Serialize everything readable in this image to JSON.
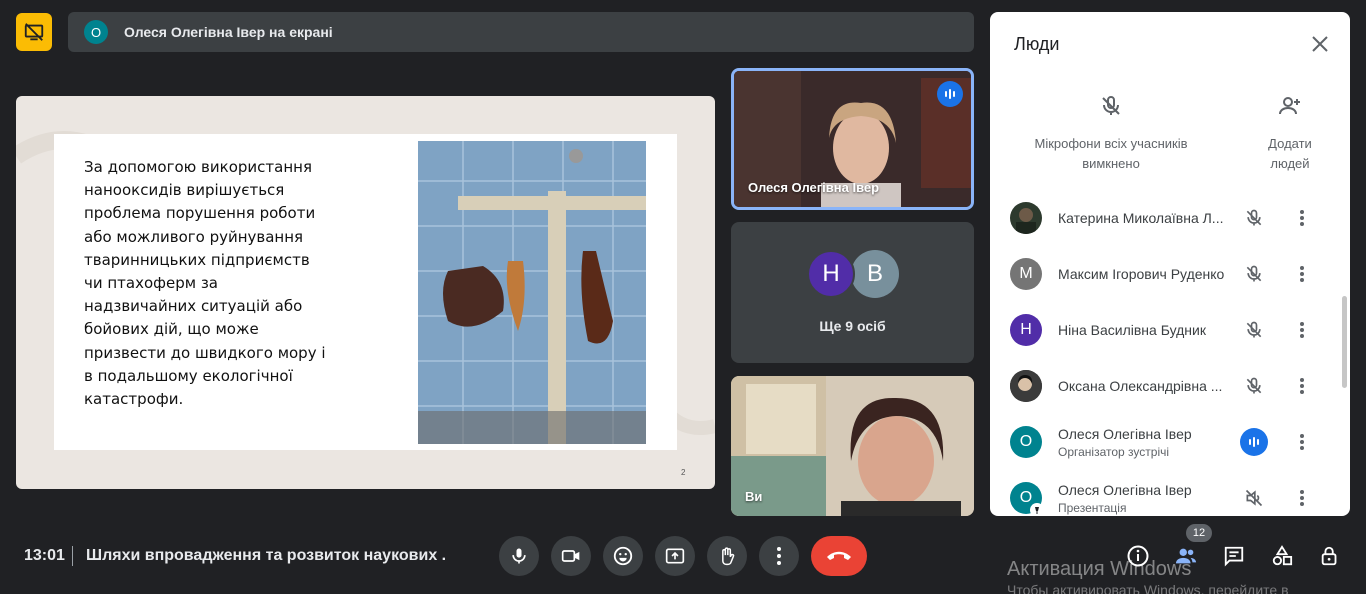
{
  "banner": {
    "avatar_letter": "О",
    "text": "Олеся Олегівна Івер на екрані"
  },
  "slide": {
    "lines": [
      "За допомогою використання",
      "нанооксидів вирішується",
      "проблема порушення роботи",
      "або можливого руйнування",
      "тваринницьких підприємств",
      "чи птахоферм за",
      "надзвичайних ситуацій або",
      "бойових дій, що може",
      "призвести до швидкого мору і",
      "в подальшому екологічної",
      "катастрофи."
    ],
    "page_mark": "2"
  },
  "tiles": {
    "presenter_name": "Олеся Олегівна Івер",
    "group_avatars": [
      "Н",
      "В"
    ],
    "more_label": "Ще 9 осіб",
    "self_name": "Ви"
  },
  "panel": {
    "title": "Люди",
    "mute_all_line1": "Мікрофони всіх учасників",
    "mute_all_line2": "вимкнено",
    "add_line1": "Додати",
    "add_line2": "людей",
    "participants": [
      {
        "name": "Катерина Миколаївна Л...",
        "letter": "",
        "role": "",
        "avatar_color": "#2d3a2e",
        "status": "muted"
      },
      {
        "name": "Максим Ігорович Руденко",
        "letter": "М",
        "role": "",
        "avatar_color": "#757575",
        "status": "muted"
      },
      {
        "name": "Ніна Василівна Будник",
        "letter": "Н",
        "role": "",
        "avatar_color": "#512da8",
        "status": "muted"
      },
      {
        "name": "Оксана Олександрівна ...",
        "letter": "",
        "role": "",
        "avatar_color": "#2b2b2b",
        "status": "muted"
      },
      {
        "name": "Олеся Олегівна Івер",
        "letter": "О",
        "role": "Організатор зустрічі",
        "avatar_color": "#00838f",
        "status": "speaking"
      },
      {
        "name": "Олеся Олегівна Івер",
        "letter": "О",
        "role": "Презентація",
        "avatar_color": "#00838f",
        "status": "volume-off"
      }
    ]
  },
  "bottom": {
    "time": "13:01",
    "meeting_title": "Шляхи впровадження та розвиток наукових ...",
    "people_count": "12"
  },
  "watermark": {
    "line1": "Активация Windows",
    "line2": "Чтобы активировать Windows, перейдите в"
  },
  "colors": {
    "accent": "#8ab4f8",
    "end_call": "#ea4335",
    "present_icon": "#fbbc04"
  }
}
